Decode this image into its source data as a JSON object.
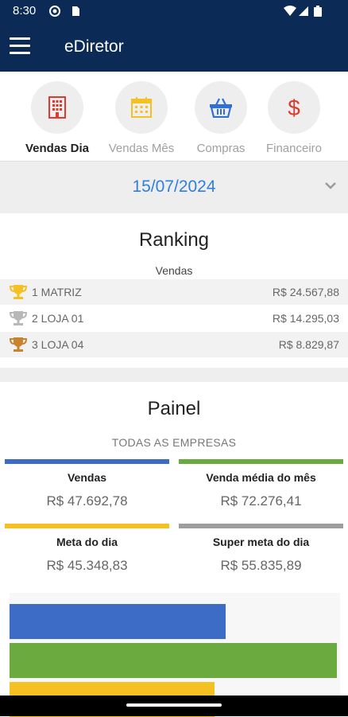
{
  "status": {
    "time": "8:30"
  },
  "appbar": {
    "title": "eDiretor"
  },
  "tabs": [
    {
      "label": "Vendas Dia",
      "icon": "building-icon",
      "active": true
    },
    {
      "label": "Vendas Mês",
      "icon": "calendar-icon",
      "active": false
    },
    {
      "label": "Compras",
      "icon": "basket-icon",
      "active": false
    },
    {
      "label": "Financeiro",
      "icon": "dollar-icon",
      "active": false
    }
  ],
  "date": {
    "value": "15/07/2024"
  },
  "ranking": {
    "title": "Ranking",
    "subtitle": "Vendas",
    "rows": [
      {
        "name": "1 MATRIZ",
        "value": "R$ 24.567,88",
        "trophy": "gold-trophy-icon"
      },
      {
        "name": "2 LOJA 01",
        "value": "R$ 14.295,03",
        "trophy": "silver-trophy-icon"
      },
      {
        "name": "3 LOJA 04",
        "value": "R$ 8.829,87",
        "trophy": "bronze-trophy-icon"
      }
    ]
  },
  "painel": {
    "title": "Painel",
    "subtitle": "TODAS AS EMPRESAS",
    "kpis": [
      {
        "label": "Vendas",
        "value": "R$ 47.692,78",
        "color": "#3d6cc7"
      },
      {
        "label": "Venda média do mês",
        "value": "R$ 72.276,41",
        "color": "#6aaa3f"
      },
      {
        "label": "Meta do dia",
        "value": "R$ 45.348,83",
        "color": "#f5c021"
      },
      {
        "label": "Super meta do dia",
        "value": "R$ 55.835,89",
        "color": "#9e9e9e"
      }
    ]
  },
  "chart_data": {
    "type": "bar",
    "orientation": "horizontal",
    "categories": [
      "Vendas",
      "Venda média do mês",
      "Meta do dia"
    ],
    "values": [
      47692.78,
      72276.41,
      45348.83
    ],
    "colors": [
      "#3d6cc7",
      "#6aaa3f",
      "#f5c021"
    ],
    "xlim": [
      0,
      73000
    ]
  },
  "colors": {
    "primary": "#0b2a55",
    "accent_date": "#2f7fe0",
    "gold": "#f5c021",
    "silver": "#b8b8b8",
    "bronze": "#c9832e"
  }
}
